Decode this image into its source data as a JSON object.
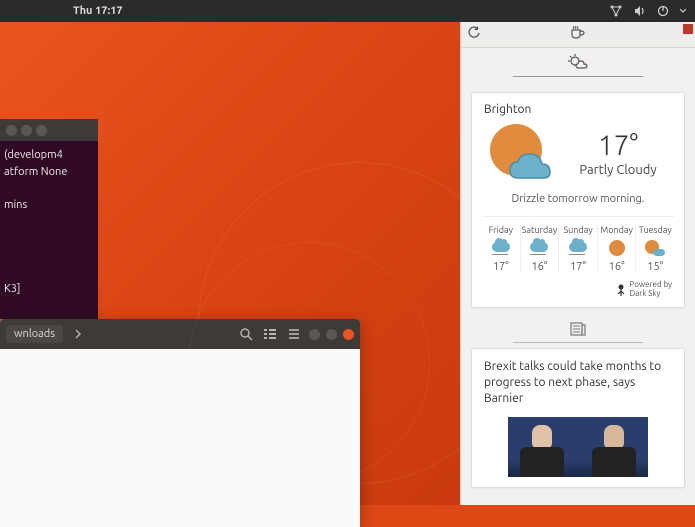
{
  "topbar": {
    "datetime": "Thu 17:17"
  },
  "terminal": {
    "line1": "(developm4",
    "line2": "atform None",
    "line3": "mins",
    "line4": "K3]"
  },
  "files": {
    "breadcrumb": "wnloads"
  },
  "sidebar": {
    "weather": {
      "location": "Brighton",
      "temp": "17°",
      "condition": "Partly Cloudy",
      "subtitle": "Drizzle tomorrow morning.",
      "days": [
        {
          "name": "Friday",
          "icon": "rain",
          "temp": "17°"
        },
        {
          "name": "Saturday",
          "icon": "rain",
          "temp": "16°"
        },
        {
          "name": "Sunday",
          "icon": "rain",
          "temp": "17°"
        },
        {
          "name": "Monday",
          "icon": "sun",
          "temp": "16°"
        },
        {
          "name": "Tuesday",
          "icon": "suncloud",
          "temp": "15°"
        }
      ],
      "attribution": "Powered by\nDark Sky"
    },
    "news": {
      "headline": "Brexit talks could take months to progress to next phase, says Barnier"
    }
  }
}
